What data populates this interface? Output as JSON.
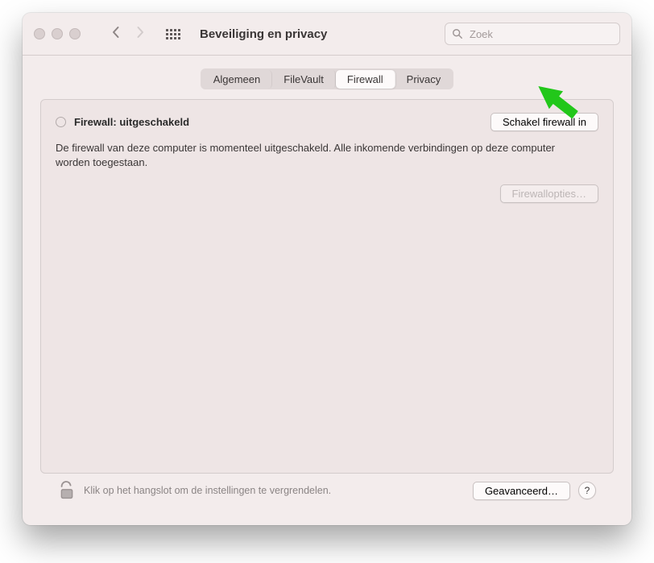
{
  "window": {
    "title": "Beveiliging en privacy"
  },
  "search": {
    "placeholder": "Zoek"
  },
  "tabs": [
    {
      "label": "Algemeen",
      "selected": false
    },
    {
      "label": "FileVault",
      "selected": false
    },
    {
      "label": "Firewall",
      "selected": true
    },
    {
      "label": "Privacy",
      "selected": false
    }
  ],
  "firewall": {
    "status_label": "Firewall: uitgeschakeld",
    "description": "De firewall van deze computer is momenteel uitgeschakeld. Alle inkomende verbindingen op deze computer worden toegestaan.",
    "enable_button": "Schakel firewall in",
    "options_button": "Firewallopties…"
  },
  "footer": {
    "lock_hint": "Klik op het hangslot om de instellingen te vergrendelen.",
    "advanced_button": "Geavanceerd…",
    "help_label": "?"
  },
  "annotation": {
    "arrow_color": "#22c71a"
  }
}
